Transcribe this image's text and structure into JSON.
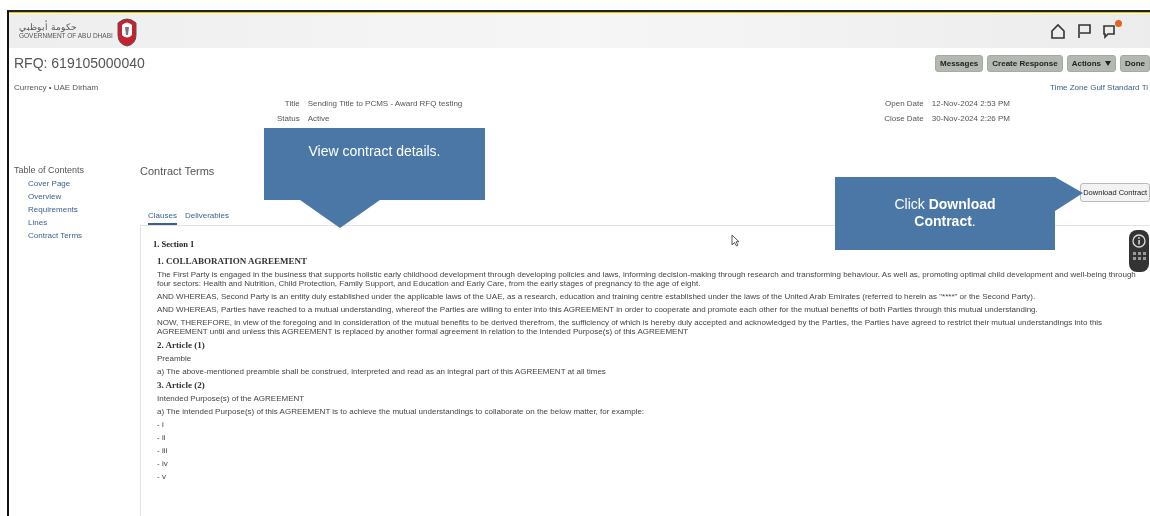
{
  "header": {
    "logo_arabic": "حكومة أبوظبي",
    "logo_english": "GOVERNMENT OF ABU DHABI",
    "notification_badge": true
  },
  "page": {
    "title": "RFQ: 619105000040",
    "buttons": [
      {
        "label": "Messages",
        "kind": "button"
      },
      {
        "label": "Create Response",
        "kind": "button"
      },
      {
        "label": "Actions",
        "kind": "menu"
      },
      {
        "label": "Done",
        "kind": "button"
      }
    ],
    "currency": "Currency • UAE Dirham",
    "time_zone": "Time Zone Gulf Standard Ti",
    "fields_left": [
      {
        "label": "Title",
        "value": "Sending Title to PCMS - Award RFQ testing"
      },
      {
        "label": "Status",
        "value": "Active"
      }
    ],
    "fields_right": [
      {
        "label": "Open Date",
        "value": "12-Nov-2024 2:53 PM"
      },
      {
        "label": "Close Date",
        "value": "30-Nov-2024 2:26 PM"
      }
    ]
  },
  "toc": {
    "title": "Table of Contents",
    "items": [
      "Cover Page",
      "Overview",
      "Requirements",
      "Lines",
      "Contract Terms"
    ]
  },
  "contract": {
    "heading": "Contract Terms",
    "download_button": "Download Contract",
    "tabs": [
      {
        "label": "Clauses",
        "selected": true
      },
      {
        "label": "Deliverables",
        "selected": false
      }
    ],
    "blocks": [
      {
        "kind": "section",
        "text": "1. Section 1"
      },
      {
        "kind": "heading",
        "text": "1. COLLABORATION AGREEMENT"
      },
      {
        "kind": "para",
        "text": "The First Party is engaged in the business that supports holistic early childhood development through developing policies and laws, informing decision-making through research and transforming behaviour. As well as, promoting optimal child development and well-being through four sectors: Health and Nutrition, Child Protection, Family Support, and Education and Early Care, from the early stages of pregnancy to the age of eight."
      },
      {
        "kind": "para",
        "text": "AND WHEREAS, Second Party is an entity duly established under the applicable laws of the UAE, as a research, education and training centre established under the laws of the United Arab Emirates (referred to herein as \"****\" or the Second Party)."
      },
      {
        "kind": "para",
        "text": "AND WHEREAS, Parties have reached to a mutual understanding, whereof the Parties are willing to enter into this AGREEMENT in order to cooperate and promote each other for the mutual benefits of both Parties through this mutual understanding."
      },
      {
        "kind": "para",
        "text": "NOW, THEREFORE, in view of the foregoing and in consideration of the mutual benefits to be derived therefrom, the sufficiency of which is hereby duly accepted and acknowledged by the Parties, the Parties have agreed to restrict their mutual understandings into this AGREEMENT until and unless this AGREEMENT is replaced by another formal agreement in relation to the Intended Purpose(s) of this AGREEMENT"
      },
      {
        "kind": "heading",
        "text": "2. Article (1)"
      },
      {
        "kind": "para",
        "text": "Preamble"
      },
      {
        "kind": "para",
        "text": "a) The above-mentioned preamble shall be construed, interpreted and read as an integral part of this AGREEMENT at all times"
      },
      {
        "kind": "heading",
        "text": "3. Article (2)"
      },
      {
        "kind": "para",
        "text": "Intended Purpose(s) of the AGREEMENT"
      },
      {
        "kind": "para",
        "text": "a) The intended Purpose(s) of this AGREEMENT is to achieve the mutual understandings to collaborate on the below matter, for example:"
      },
      {
        "kind": "item",
        "text": "- i"
      },
      {
        "kind": "item",
        "text": "- ii"
      },
      {
        "kind": "item",
        "text": "- iii"
      },
      {
        "kind": "item",
        "text": "- iv"
      },
      {
        "kind": "item",
        "text": "- v"
      }
    ]
  },
  "callouts": [
    {
      "text": "View contract details.",
      "kind": "down"
    },
    {
      "text": "Click **Download Contract**.",
      "kind": "right"
    }
  ]
}
